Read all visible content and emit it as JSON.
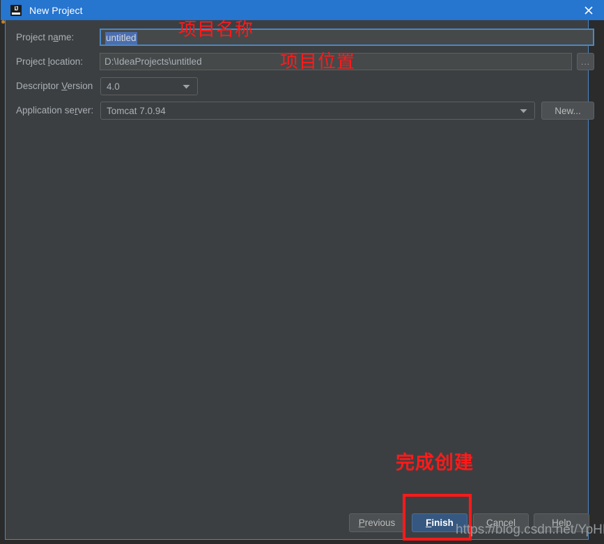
{
  "window": {
    "title": "New Project",
    "app_icon": "intellij-idea-icon",
    "icon_letters": "IJ",
    "close_icon": "close-icon",
    "titlebar_color": "#2675cf",
    "dialog_bg": "#3c3f41",
    "border_color": "#4a88c7"
  },
  "form": {
    "rows": [
      {
        "label_pre": "Project n",
        "label_mnemonic": "a",
        "label_post": "me:",
        "value": "untitled",
        "control": "text-input",
        "focused": true,
        "selected": true
      },
      {
        "label_pre": "Project ",
        "label_mnemonic": "l",
        "label_post": "ocation:",
        "value": "D:\\IdeaProjects\\untitled",
        "control": "text-input",
        "focused": false,
        "selected": false
      },
      {
        "label_pre": "Descriptor ",
        "label_mnemonic": "V",
        "label_post": "ersion",
        "value": "4.0",
        "control": "combobox",
        "focused": false,
        "selected": false
      },
      {
        "label_pre": "Application se",
        "label_mnemonic": "r",
        "label_post": "ver:",
        "value": "Tomcat 7.0.94",
        "control": "combobox",
        "focused": false,
        "selected": false
      }
    ],
    "browse_button_label": "...",
    "new_server_button_label": "New..."
  },
  "footer": {
    "buttons": [
      {
        "pre": "",
        "mnemonic": "P",
        "post": "revious",
        "label": "Previous",
        "primary": false
      },
      {
        "pre": "",
        "mnemonic": "F",
        "post": "inish",
        "label": "Finish",
        "primary": true
      },
      {
        "pre": "",
        "mnemonic": "C",
        "post": "ancel",
        "label": "Cancel",
        "primary": false
      },
      {
        "pre": "",
        "mnemonic": "H",
        "post": "elp",
        "label": "Help",
        "primary": false
      }
    ],
    "primary_color": "#365880"
  },
  "annotations": {
    "color": "#ff1a1a",
    "project_name": "项目名称",
    "project_location": "项目位置",
    "finish_create": "完成创建",
    "highlight_target": "finish-button"
  },
  "watermark": {
    "text": "https://blog.csdn.net/YpHDM"
  }
}
